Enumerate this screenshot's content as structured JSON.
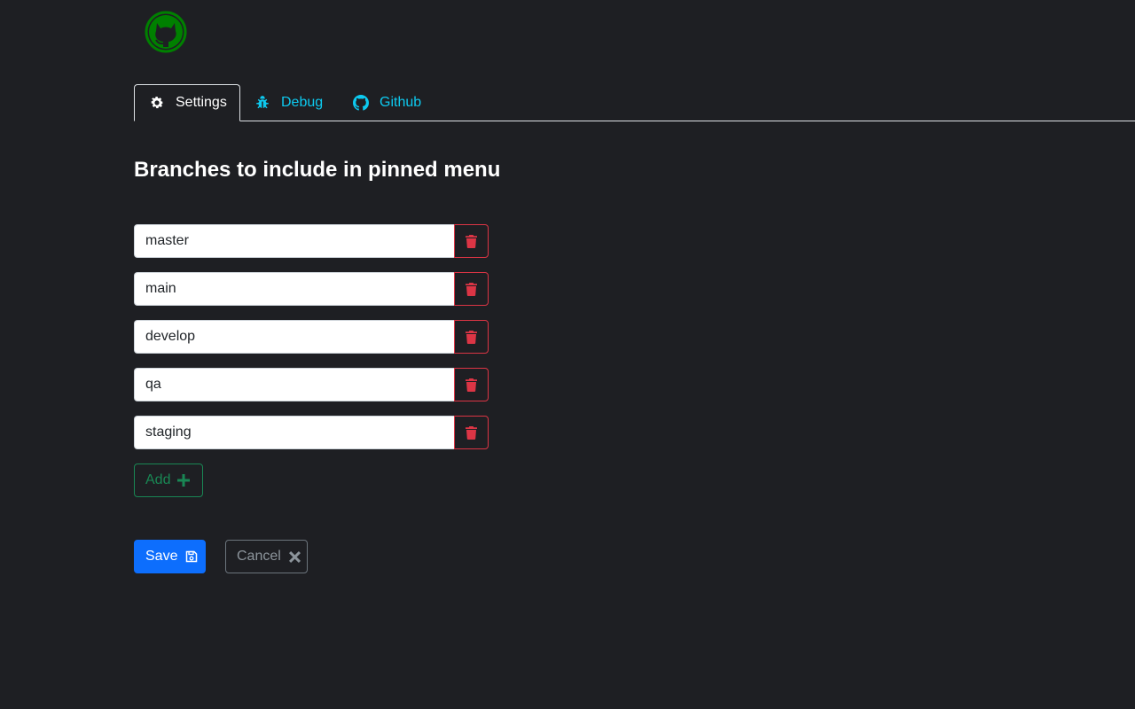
{
  "colors": {
    "background": "#1e1f23",
    "logo_green": "#008000",
    "tab_link": "#0dcaf0",
    "danger": "#dc3545",
    "success": "#198754",
    "primary": "#0d6efd",
    "secondary": "#6c757d"
  },
  "logo": {
    "icon": "github-octocat-icon"
  },
  "tabs": [
    {
      "label": "Settings",
      "icon": "gear-icon",
      "active": true
    },
    {
      "label": "Debug",
      "icon": "bug-icon",
      "active": false
    },
    {
      "label": "Github",
      "icon": "github-icon",
      "active": false
    }
  ],
  "main": {
    "title": "Branches to include in pinned menu",
    "branches": [
      {
        "value": "master",
        "delete_icon": "trash-icon"
      },
      {
        "value": "main",
        "delete_icon": "trash-icon"
      },
      {
        "value": "develop",
        "delete_icon": "trash-icon"
      },
      {
        "value": "qa",
        "delete_icon": "trash-icon"
      },
      {
        "value": "staging",
        "delete_icon": "trash-icon"
      }
    ],
    "add_label": "Add",
    "add_icon": "plus-icon"
  },
  "actions": {
    "save_label": "Save",
    "save_icon": "floppy-disk-icon",
    "cancel_label": "Cancel",
    "cancel_icon": "close-icon"
  }
}
